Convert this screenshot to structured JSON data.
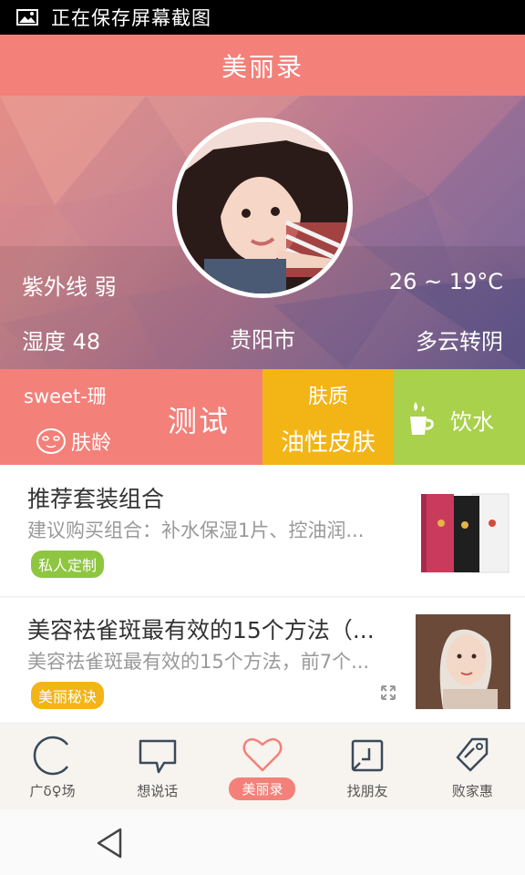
{
  "status_bar": {
    "text": "正在保存屏幕截图",
    "icon": "image-icon"
  },
  "header": {
    "title": "美丽录"
  },
  "hero": {
    "uv": "紫外线 弱",
    "temperature": "26 ~ 19°C",
    "humidity": "湿度 48",
    "city": "贵阳市",
    "weather": "多云转阴"
  },
  "features": {
    "test": {
      "user": "sweet-珊",
      "skin_age": "肤龄",
      "button": "测试"
    },
    "skin": {
      "label": "肤质",
      "value": "油性皮肤"
    },
    "water": {
      "label": "饮水"
    }
  },
  "cards": [
    {
      "title": "推荐套装组合",
      "desc": "建议购买组合：补水保湿1片、控油润...",
      "tag": "私人定制"
    },
    {
      "title": "美容祛雀斑最有效的15个方法（...",
      "desc": "美容祛雀斑最有效的15个方法，前7个...",
      "tag": "美丽秘诀"
    }
  ],
  "tabs": [
    {
      "label": "广δ♀场",
      "icon": "circle-icon"
    },
    {
      "label": "想说话",
      "icon": "speech-bubble-icon"
    },
    {
      "label": "美丽录",
      "icon": "heart-icon",
      "active": true
    },
    {
      "label": "找朋友",
      "icon": "friend-icon"
    },
    {
      "label": "败家惠",
      "icon": "tag-icon"
    }
  ],
  "colors": {
    "primary": "#f38079",
    "yellow": "#f3b515",
    "green": "#a9d14b"
  }
}
